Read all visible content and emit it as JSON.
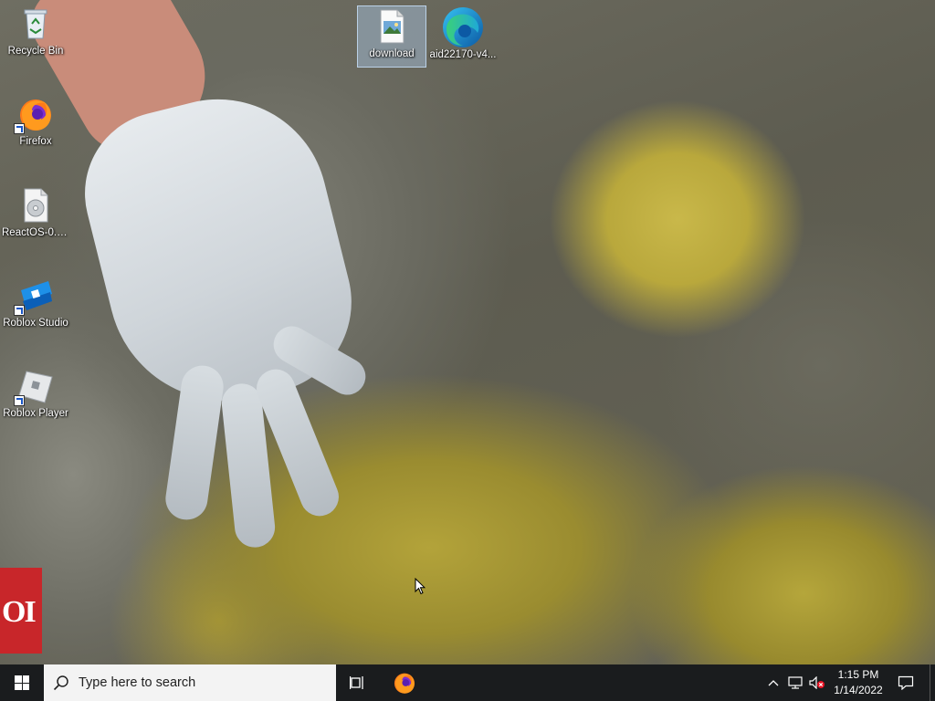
{
  "desktop": {
    "icons": [
      {
        "label": "Recycle Bin",
        "icon": "recycle-bin-icon"
      },
      {
        "label": "Firefox",
        "icon": "firefox-icon"
      },
      {
        "label": "ReactOS-0.4...",
        "icon": "disc-image-icon"
      },
      {
        "label": "Roblox Studio",
        "icon": "roblox-studio-icon"
      },
      {
        "label": "Roblox Player",
        "icon": "roblox-player-icon"
      },
      {
        "label": "download",
        "icon": "image-file-icon"
      },
      {
        "label": "aid22170-v4...",
        "icon": "edge-icon"
      }
    ],
    "wallpaper_badge_text": "OI"
  },
  "taskbar": {
    "search_placeholder": "Type here to search",
    "pinned": [
      "task-view-icon",
      "firefox-icon"
    ],
    "tray_icons": [
      "chevron-up-icon",
      "network-icon",
      "volume-muted-icon"
    ],
    "clock": {
      "time": "1:15 PM",
      "date": "1/14/2022"
    },
    "notification_icon": "action-center-icon"
  },
  "colors": {
    "taskbar": "#1a1c1e",
    "search_box": "#f3f3f3",
    "accent_blue": "#0f6cbd"
  }
}
